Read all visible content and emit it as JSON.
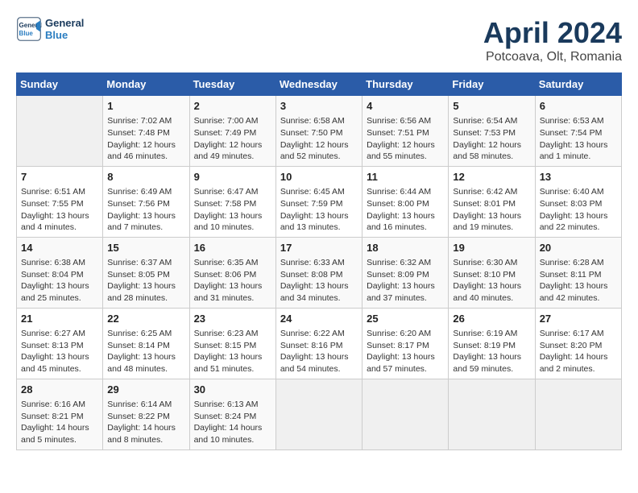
{
  "header": {
    "logo_line1": "General",
    "logo_line2": "Blue",
    "month": "April 2024",
    "location": "Potcoava, Olt, Romania"
  },
  "weekdays": [
    "Sunday",
    "Monday",
    "Tuesday",
    "Wednesday",
    "Thursday",
    "Friday",
    "Saturday"
  ],
  "weeks": [
    [
      {
        "day": "",
        "info": ""
      },
      {
        "day": "1",
        "info": "Sunrise: 7:02 AM\nSunset: 7:48 PM\nDaylight: 12 hours\nand 46 minutes."
      },
      {
        "day": "2",
        "info": "Sunrise: 7:00 AM\nSunset: 7:49 PM\nDaylight: 12 hours\nand 49 minutes."
      },
      {
        "day": "3",
        "info": "Sunrise: 6:58 AM\nSunset: 7:50 PM\nDaylight: 12 hours\nand 52 minutes."
      },
      {
        "day": "4",
        "info": "Sunrise: 6:56 AM\nSunset: 7:51 PM\nDaylight: 12 hours\nand 55 minutes."
      },
      {
        "day": "5",
        "info": "Sunrise: 6:54 AM\nSunset: 7:53 PM\nDaylight: 12 hours\nand 58 minutes."
      },
      {
        "day": "6",
        "info": "Sunrise: 6:53 AM\nSunset: 7:54 PM\nDaylight: 13 hours\nand 1 minute."
      }
    ],
    [
      {
        "day": "7",
        "info": "Sunrise: 6:51 AM\nSunset: 7:55 PM\nDaylight: 13 hours\nand 4 minutes."
      },
      {
        "day": "8",
        "info": "Sunrise: 6:49 AM\nSunset: 7:56 PM\nDaylight: 13 hours\nand 7 minutes."
      },
      {
        "day": "9",
        "info": "Sunrise: 6:47 AM\nSunset: 7:58 PM\nDaylight: 13 hours\nand 10 minutes."
      },
      {
        "day": "10",
        "info": "Sunrise: 6:45 AM\nSunset: 7:59 PM\nDaylight: 13 hours\nand 13 minutes."
      },
      {
        "day": "11",
        "info": "Sunrise: 6:44 AM\nSunset: 8:00 PM\nDaylight: 13 hours\nand 16 minutes."
      },
      {
        "day": "12",
        "info": "Sunrise: 6:42 AM\nSunset: 8:01 PM\nDaylight: 13 hours\nand 19 minutes."
      },
      {
        "day": "13",
        "info": "Sunrise: 6:40 AM\nSunset: 8:03 PM\nDaylight: 13 hours\nand 22 minutes."
      }
    ],
    [
      {
        "day": "14",
        "info": "Sunrise: 6:38 AM\nSunset: 8:04 PM\nDaylight: 13 hours\nand 25 minutes."
      },
      {
        "day": "15",
        "info": "Sunrise: 6:37 AM\nSunset: 8:05 PM\nDaylight: 13 hours\nand 28 minutes."
      },
      {
        "day": "16",
        "info": "Sunrise: 6:35 AM\nSunset: 8:06 PM\nDaylight: 13 hours\nand 31 minutes."
      },
      {
        "day": "17",
        "info": "Sunrise: 6:33 AM\nSunset: 8:08 PM\nDaylight: 13 hours\nand 34 minutes."
      },
      {
        "day": "18",
        "info": "Sunrise: 6:32 AM\nSunset: 8:09 PM\nDaylight: 13 hours\nand 37 minutes."
      },
      {
        "day": "19",
        "info": "Sunrise: 6:30 AM\nSunset: 8:10 PM\nDaylight: 13 hours\nand 40 minutes."
      },
      {
        "day": "20",
        "info": "Sunrise: 6:28 AM\nSunset: 8:11 PM\nDaylight: 13 hours\nand 42 minutes."
      }
    ],
    [
      {
        "day": "21",
        "info": "Sunrise: 6:27 AM\nSunset: 8:13 PM\nDaylight: 13 hours\nand 45 minutes."
      },
      {
        "day": "22",
        "info": "Sunrise: 6:25 AM\nSunset: 8:14 PM\nDaylight: 13 hours\nand 48 minutes."
      },
      {
        "day": "23",
        "info": "Sunrise: 6:23 AM\nSunset: 8:15 PM\nDaylight: 13 hours\nand 51 minutes."
      },
      {
        "day": "24",
        "info": "Sunrise: 6:22 AM\nSunset: 8:16 PM\nDaylight: 13 hours\nand 54 minutes."
      },
      {
        "day": "25",
        "info": "Sunrise: 6:20 AM\nSunset: 8:17 PM\nDaylight: 13 hours\nand 57 minutes."
      },
      {
        "day": "26",
        "info": "Sunrise: 6:19 AM\nSunset: 8:19 PM\nDaylight: 13 hours\nand 59 minutes."
      },
      {
        "day": "27",
        "info": "Sunrise: 6:17 AM\nSunset: 8:20 PM\nDaylight: 14 hours\nand 2 minutes."
      }
    ],
    [
      {
        "day": "28",
        "info": "Sunrise: 6:16 AM\nSunset: 8:21 PM\nDaylight: 14 hours\nand 5 minutes."
      },
      {
        "day": "29",
        "info": "Sunrise: 6:14 AM\nSunset: 8:22 PM\nDaylight: 14 hours\nand 8 minutes."
      },
      {
        "day": "30",
        "info": "Sunrise: 6:13 AM\nSunset: 8:24 PM\nDaylight: 14 hours\nand 10 minutes."
      },
      {
        "day": "",
        "info": ""
      },
      {
        "day": "",
        "info": ""
      },
      {
        "day": "",
        "info": ""
      },
      {
        "day": "",
        "info": ""
      }
    ]
  ]
}
